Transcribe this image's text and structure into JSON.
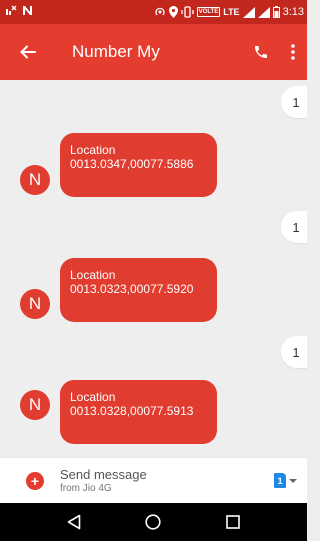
{
  "status_bar": {
    "volte": "VOLTE",
    "lte": "LTE",
    "time": "3:13",
    "icons": [
      "notification-icon",
      "n-icon",
      "hotspot-icon",
      "location-icon",
      "vibrate-icon",
      "signal-icon",
      "signal-icon-2",
      "battery-icon"
    ]
  },
  "toolbar": {
    "title": "Number My",
    "back_icon": "arrow-back-icon",
    "call_icon": "phone-icon",
    "more_icon": "more-vert-icon"
  },
  "messages": [
    {
      "type": "sent",
      "text": "1"
    },
    {
      "type": "received",
      "avatar": "N",
      "lines": [
        "Location",
        "0013.0347,00077.5886"
      ]
    },
    {
      "type": "sent",
      "text": "1"
    },
    {
      "type": "received",
      "avatar": "N",
      "lines": [
        "Location",
        "0013.0323,00077.5920"
      ]
    },
    {
      "type": "sent",
      "text": "1"
    },
    {
      "type": "received",
      "avatar": "N",
      "lines": [
        "Location",
        "0013.0328,00077.5913"
      ]
    }
  ],
  "compose": {
    "placeholder": "Send message",
    "subtext": "from Jio 4G",
    "sim_number": "1"
  },
  "colors": {
    "status_bar": "#c2271e",
    "toolbar": "#e53c30",
    "bubble_received": "#e03c2f",
    "background": "#eeeeee",
    "sim_badge": "#1e88e5"
  }
}
